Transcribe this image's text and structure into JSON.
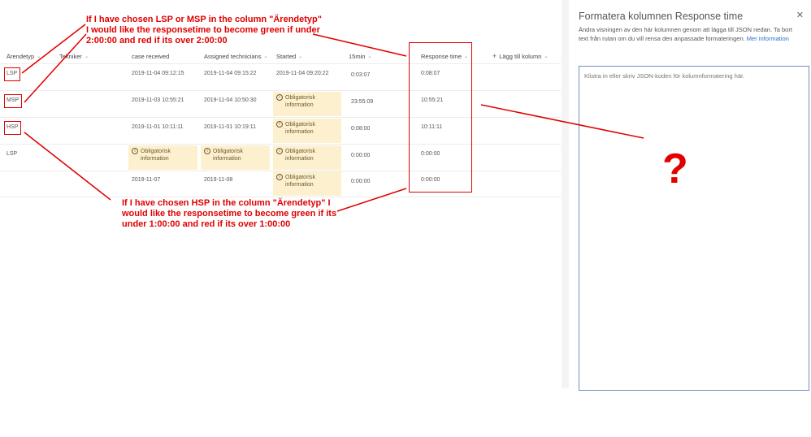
{
  "columns": [
    {
      "label": "Ärendetyp"
    },
    {
      "label": "Tekniker"
    },
    {
      "label": "case received"
    },
    {
      "label": "Assigned technicians"
    },
    {
      "label": "Started"
    },
    {
      "label": "15min"
    },
    {
      "label": "Response time"
    },
    {
      "label": "Lägg till kolumn"
    }
  ],
  "required_text": {
    "line1": "Obligatorisk",
    "line2": "information"
  },
  "rows": [
    {
      "arendetyp": "LSP",
      "case_received": "2019-11-04 09:12:15",
      "assigned": "2019-11-04 09:15:22",
      "started": "2019-11-04 09:20:22",
      "min15": "0:03:07",
      "response": "0:08:07"
    },
    {
      "arendetyp": "MSP",
      "case_received": "2019-11-03 10:55:21",
      "assigned": "2019-11-04 10:50:30",
      "started": "",
      "min15": "23:55:09",
      "response": "10:55:21"
    },
    {
      "arendetyp": "HSP",
      "case_received": "2019-11-01 10:11:11",
      "assigned": "2019-11-01 10:19:11",
      "started": "",
      "min15": "0:08:00",
      "response": "10:11:11"
    },
    {
      "arendetyp": "LSP",
      "case_received": "",
      "assigned": "",
      "started": "",
      "min15": "0:00:00",
      "response": "0:00:00"
    },
    {
      "arendetyp": "",
      "case_received": "2019-11-07",
      "assigned": "2019-11-08",
      "started": "",
      "min15": "0:00:00",
      "response": "0:00:00"
    }
  ],
  "panel": {
    "title": "Formatera kolumnen Response time",
    "close_icon": "✕",
    "description": "Ändra visningen av den här kolumnen genom att lägga till JSON nedan. Ta bort text från rutan om du vill rensa den anpassade formateringen.",
    "more_link": "Mer information",
    "editor_placeholder": "Klistra in eller skriv JSON-koden för kolumnformatering här."
  },
  "annotations": {
    "top": "If I have chosen LSP or MSP in the column \"Ärendetyp\" I would like the responsetime to become green if under 2:00:00 and red if its over 2:00:00",
    "bottom": "If I have chosen HSP in the column \"Ärendetyp\" I would like the responsetime to become green if its under 1:00:00 and red if its over 1:00:00",
    "question": "?"
  },
  "colors": {
    "annotation": "#e00000",
    "required_bg": "#fdf0cf",
    "link": "#2b6fd0"
  }
}
